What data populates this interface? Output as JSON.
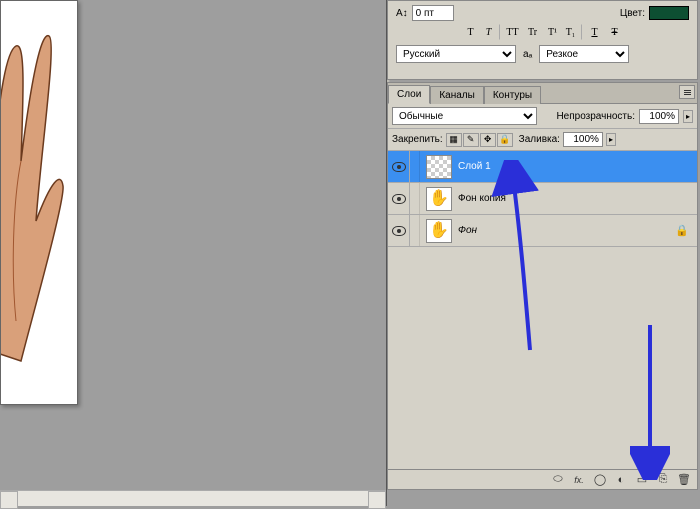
{
  "character_panel": {
    "leading_icon": "A↕",
    "leading_value": "0 пт",
    "color_label": "Цвет:",
    "color_value": "#0d4f32",
    "style_buttons": [
      "T",
      "T",
      "TT",
      "Tr",
      "T¹",
      "T₁",
      "T",
      "Ŧ"
    ],
    "language_options": [
      "Русский"
    ],
    "language_value": "Русский",
    "aa_icon": "aₐ",
    "aa_options": [
      "Резкое"
    ],
    "aa_value": "Резкое"
  },
  "layers_panel": {
    "tabs": {
      "layers": "Слои",
      "channels": "Каналы",
      "paths": "Контуры"
    },
    "blend_mode_options": [
      "Обычные"
    ],
    "blend_mode_value": "Обычные",
    "opacity_label": "Непрозрачность:",
    "opacity_value": "100%",
    "lock_label": "Закрепить:",
    "fill_label": "Заливка:",
    "fill_value": "100%",
    "layers": [
      {
        "name": "Слой 1",
        "selected": true,
        "transparent_thumb": true,
        "locked": false,
        "italic": false
      },
      {
        "name": "Фон копия",
        "selected": false,
        "transparent_thumb": false,
        "locked": false,
        "italic": false
      },
      {
        "name": "Фон",
        "selected": false,
        "transparent_thumb": false,
        "locked": true,
        "italic": true
      }
    ],
    "footer_icons": {
      "link": "⌘",
      "fx": "fx.",
      "mask": "◯",
      "adjust": "◐",
      "group": "▭",
      "new": "⎘",
      "trash": "🗑"
    }
  }
}
